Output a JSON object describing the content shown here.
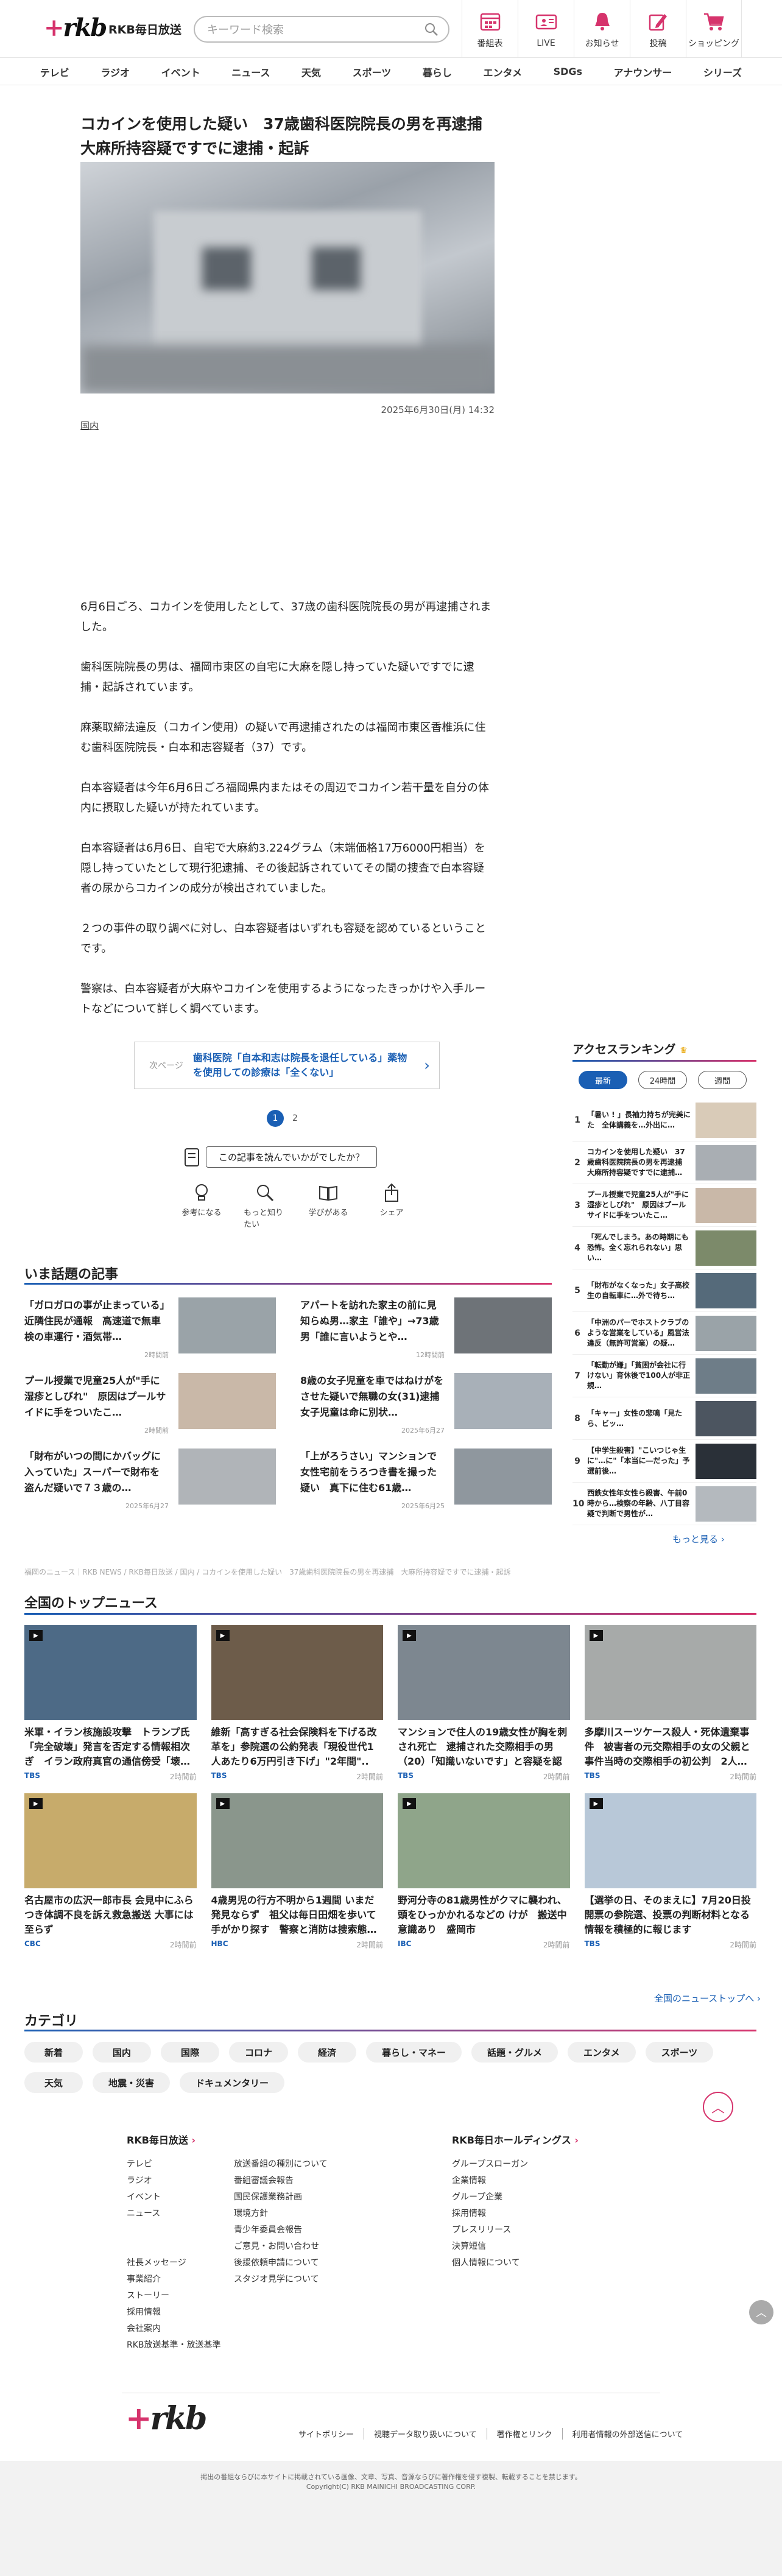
{
  "header": {
    "brand": "RKB毎日放送",
    "search_placeholder": "キーワード検索",
    "icons": [
      {
        "label": "番組表",
        "icon": "calendar-icon"
      },
      {
        "label": "LIVE",
        "icon": "tv-icon"
      },
      {
        "label": "お知らせ",
        "icon": "bell-icon"
      },
      {
        "label": "投稿",
        "icon": "pencil-icon"
      },
      {
        "label": "ショッピング",
        "icon": "cart-icon"
      }
    ]
  },
  "nav": [
    "テレビ",
    "ラジオ",
    "イベント",
    "ニュース",
    "天気",
    "スポーツ",
    "暮らし",
    "エンタメ",
    "SDGs",
    "アナウンサー",
    "シリーズ"
  ],
  "article": {
    "title": "コカインを使用した疑い　37歳歯科医院院長の男を再逮捕　大麻所持容疑ですでに逮捕・起訴",
    "date": "2025年6月30日(月) 14:32",
    "category": "国内",
    "paragraphs": [
      "6月6日ごろ、コカインを使用したとして、37歳の歯科医院院長の男が再逮捕されました。",
      "歯科医院院長の男は、福岡市東区の自宅に大麻を隠し持っていた疑いですでに逮捕・起訴されています。",
      "麻薬取締法違反（コカイン使用）の疑いで再逮捕されたのは福岡市東区香椎浜に住む歯科医院院長・白本和志容疑者（37）です。",
      "白本容疑者は今年6月6日ごろ福岡県内またはその周辺でコカイン若干量を自分の体内に摂取した疑いが持たれています。",
      "白本容疑者は6月6日、自宅で大麻約3.224グラム（末端価格17万6000円相当）を隠し持っていたとして現行犯逮捕、その後起訴されていてその間の捜査で白本容疑者の尿からコカインの成分が検出されていました。",
      "２つの事件の取り調べに対し、白本容疑者はいずれも容疑を認めているということです。",
      "警察は、白本容疑者が大麻やコカインを使用するようになったきっかけや入手ルートなどについて詳しく調べています。"
    ],
    "next_label": "次ページ",
    "next_text": "歯科医院「自本和志は院長を退任している」薬物を使用しての診療は「全くない」",
    "pages": [
      "1",
      "2"
    ],
    "feedback_question": "この記事を読んでいかがでしたか？",
    "reactions": [
      {
        "label": "参考になる",
        "icon": "lightbulb-icon"
      },
      {
        "label": "もっと知りたい",
        "icon": "magnifier-icon"
      },
      {
        "label": "学びがある",
        "icon": "book-icon"
      },
      {
        "label": "シェア",
        "icon": "share-icon"
      }
    ]
  },
  "trending": {
    "heading": "いま話題の記事",
    "items": [
      {
        "title": "「ガロガロの事が止まっている」近隣住民が通報　高速道で無車検の車運行・酒気帯…",
        "date": "2時間前",
        "color": "#9aa3a8"
      },
      {
        "title": "アパートを訪れた家主の前に見知らぬ男…家主「誰や」→73歳男「誰に言いようとや…",
        "date": "12時間前",
        "color": "#6e7378"
      },
      {
        "title": "プール授業で児童25人が\"手に湿疹としびれ\"　原因はプールサイドに手をついたこ…",
        "date": "2時間前",
        "color": "#c9b8a8"
      },
      {
        "title": "8歳の女子児童を車ではねけがをさせた疑いで無職の女(31)逮捕　女子児童は命に別状…",
        "date": "2025年6月27",
        "color": "#a8b0b8"
      },
      {
        "title": "「財布がいつの間にかバッグに入っていた」スーパーで財布を盗んだ疑いで７３歳の…",
        "date": "2025年6月27",
        "color": "#b0b4b8"
      },
      {
        "title": "「上がろうさい」マンションで女性宅前をうろつき書を撮った疑い　真下に住む61歳…",
        "date": "2025年6月25",
        "color": "#8f979e"
      }
    ]
  },
  "ranking": {
    "heading": "アクセスランキング",
    "tabs": [
      "最新",
      "24時間",
      "週間"
    ],
    "items": [
      {
        "n": "1",
        "title": "「暑い ! 」長袖力持ちが完美にた　全体講義を…外出に…",
        "color": "#d9cbb8"
      },
      {
        "n": "2",
        "title": "コカインを使用した疑い　37歳歯科医院院長の男を再逮捕　大麻所持容疑ですでに逮捕…",
        "color": "#a9aeb3"
      },
      {
        "n": "3",
        "title": "プール授業で児童25人が\"手に湿疹としびれ\"　原因はプールサイドに手をついたこ…",
        "color": "#c9b8a8"
      },
      {
        "n": "4",
        "title": "「死んでしまう。あの時期にも恐怖。全く忘れられない」思い…",
        "color": "#7c8a6a"
      },
      {
        "n": "5",
        "title": "「財布がなくなった」女子高校生の自転車に…外で待ち…",
        "color": "#556a7a"
      },
      {
        "n": "6",
        "title": "「中洲のパーでホストクラブのような営業をしている」風営法違反（無許可営業）の疑…",
        "color": "#9aa3a8"
      },
      {
        "n": "7",
        "title": "「転勤が嫌」「貧困が会社に行けない」育休後で100人が非正規…",
        "color": "#6e7d88"
      },
      {
        "n": "8",
        "title": "「キャー」女性の悲鳴「見たら、ビッ…",
        "color": "#4c5560"
      },
      {
        "n": "9",
        "title": "【中学生殺害】\"こいつじゃ生に\"…に\"「本当に―だった」予選前後…",
        "color": "#2a3038"
      },
      {
        "n": "10",
        "title": "西鉄女性年女性ら殺害、午前0時から…検察の年齢、八丁目容疑で判断で男性が…",
        "color": "#b4b9be"
      }
    ],
    "more": "もっと見る"
  },
  "breadcrumb": "福岡のニュース｜RKB NEWS / RKB毎日放送 / 国内 / コカインを使用した疑い　37歳歯科医院院長の男を再逮捕　大麻所持容疑ですでに逮捕・起訴",
  "national": {
    "heading": "全国のトップニュース",
    "items": [
      {
        "title": "米軍・イラン核施設攻撃　トランプ氏「完全破壊」発言を否定する情報相次ぎ　イラン政府真官の通信傍受「壊…",
        "source": "TBS",
        "date": "2時間前",
        "color": "#4d6a86"
      },
      {
        "title": "維新「高すぎる社会保険料を下げる改革を」参院選の公約発表「現役世代1人あたり6万円引き下げ」\"2年間\"..",
        "source": "TBS",
        "date": "2時間前",
        "color": "#6d5c4a"
      },
      {
        "title": "マンションで住人の19歳女性が胸を刺され死亡　逮捕された交際相手の男（20）「知識いないです」と容疑を認め…",
        "source": "TBS",
        "date": "2時間前",
        "color": "#7d8790"
      },
      {
        "title": "多摩川スーツケース殺人・死体遺棄事件　被害者の元交際相手の女の父親と事件当時の交際相手の初公判　2人…",
        "source": "TBS",
        "date": "2時間前",
        "color": "#a7aaa9"
      },
      {
        "title": "名古屋市の広沢一郎市長 会見中にふらつき体調不良を訴え救急搬送 大事には至らず",
        "source": "CBC",
        "date": "2時間前",
        "color": "#c7ab6b"
      },
      {
        "title": "4歳男児の行方不明から1週間 いまだ発見ならず　祖父は毎日田畑を歩いて手がかり探す　警察と消防は捜索態…",
        "source": "HBC",
        "date": "2時間前",
        "color": "#8a968c"
      },
      {
        "title": "野河分寺の81歳男性がクマに襲われ、頭をひっかかれるなどの けが　搬送中意識あり　盛岡市",
        "source": "IBC",
        "date": "2時間前",
        "color": "#8fa58a"
      },
      {
        "title": "【選挙の日、そのまえに】7月20日投開票の参院選、投票の判断材料となる情報を積極的に報じます",
        "source": "TBS",
        "date": "2時間前",
        "color": "#b8c8d8"
      }
    ],
    "more": "全国のニューストップへ"
  },
  "categories": {
    "heading": "カテゴリ",
    "items": [
      "新着",
      "国内",
      "国際",
      "コロナ",
      "経済",
      "暮らし・マネー",
      "話題・グルメ",
      "エンタメ",
      "スポーツ",
      "天気",
      "地震・災害",
      "ドキュメンタリー"
    ]
  },
  "footer": {
    "col1_heading": "RKB毎日放送",
    "col1a": [
      "テレビ",
      "ラジオ",
      "イベント",
      "ニュース",
      "",
      "",
      "社長メッセージ",
      "事業紹介",
      "ストーリー",
      "採用情報",
      "会社案内",
      "RKB放送基準・放送基準"
    ],
    "col1b": [
      "放送番組の種別について",
      "番組審議会報告",
      "国民保護業務計画",
      "環境方針",
      "青少年委員会報告",
      "ご意見・お問い合わせ",
      "後援依頼申請について",
      "スタジオ見学について"
    ],
    "col2_heading": "RKB毎日ホールディングス",
    "col2": [
      "グループスローガン",
      "企業情報",
      "グループ企業",
      "採用情報",
      "プレスリリース",
      "決算短信",
      "個人情報について"
    ],
    "bottom_links": [
      "サイトポリシー",
      "視聴データ取り扱いについて",
      "著作権とリンク",
      "利用者情報の外部送信について"
    ],
    "notice": "掲出の番組ならびに本サイトに掲載されている画像、文章、写真、音源ならびに著作権を侵す複製、転載することを禁じます。",
    "copyright": "Copyright(C) RKB MAINICHI BROADCASTING CORP."
  },
  "colors": {
    "accent": "#d6336c",
    "link": "#1a5fb4"
  }
}
